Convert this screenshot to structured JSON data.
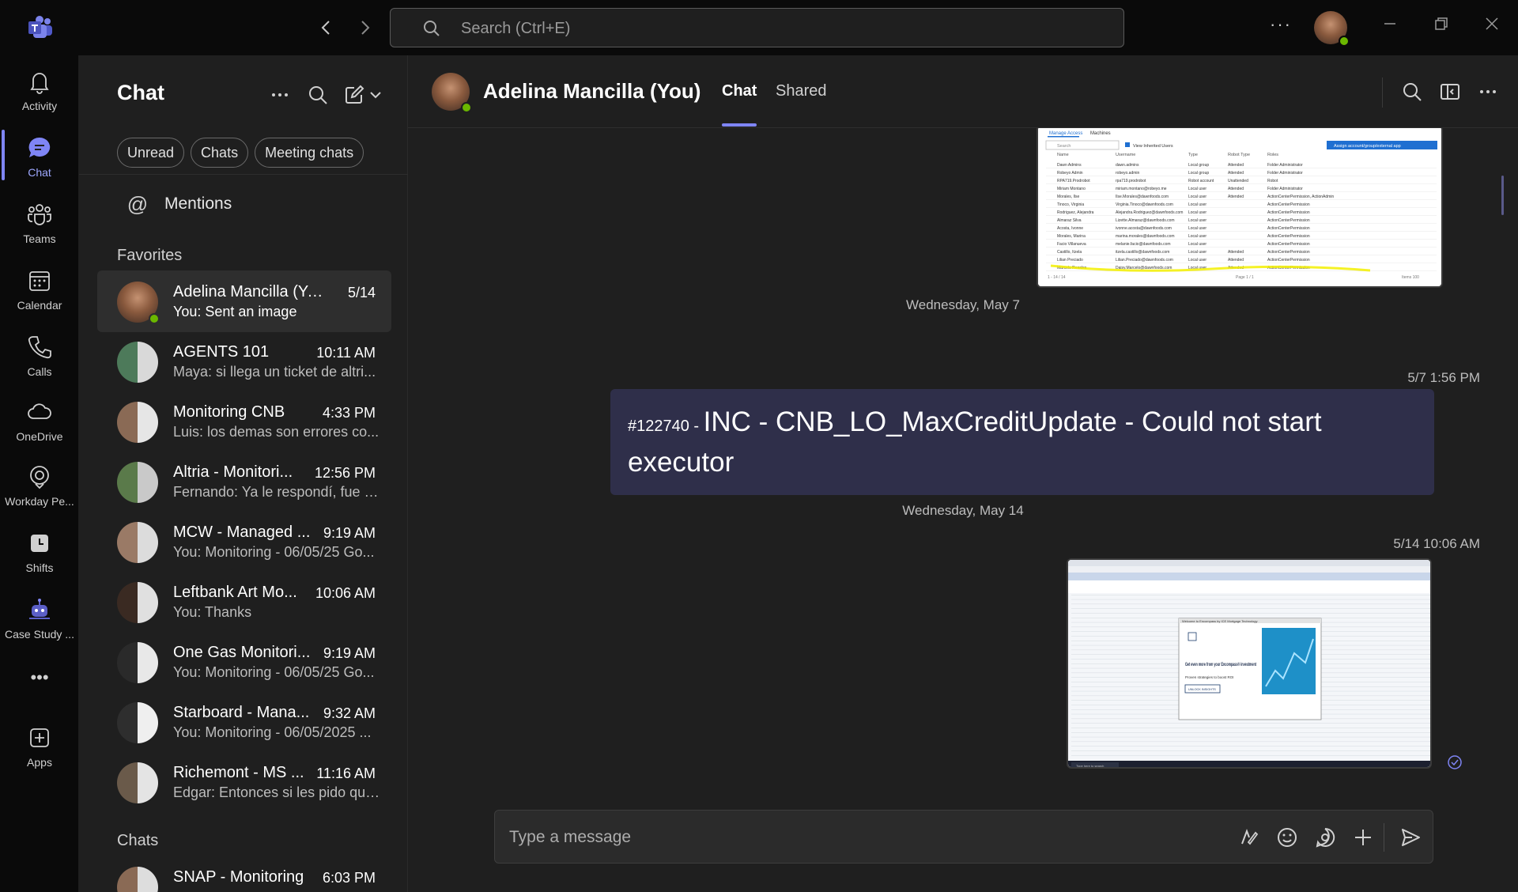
{
  "titlebar": {
    "search_placeholder": "Search (Ctrl+E)",
    "more_label": "···"
  },
  "rail": {
    "items": [
      {
        "label": "Activity",
        "icon": "bell-icon"
      },
      {
        "label": "Chat",
        "icon": "chat-icon",
        "active": true
      },
      {
        "label": "Teams",
        "icon": "teams-icon"
      },
      {
        "label": "Calendar",
        "icon": "calendar-icon"
      },
      {
        "label": "Calls",
        "icon": "phone-icon"
      },
      {
        "label": "OneDrive",
        "icon": "cloud-icon"
      },
      {
        "label": "Workday Pe...",
        "icon": "workday-icon"
      },
      {
        "label": "Shifts",
        "icon": "shifts-icon"
      },
      {
        "label": "Case Study ...",
        "icon": "bot-icon"
      },
      {
        "label": "Apps",
        "icon": "add-app-icon"
      }
    ],
    "more_label": "•••"
  },
  "chat_list": {
    "title": "Chat",
    "filters": [
      "Unread",
      "Chats",
      "Meeting chats"
    ],
    "mentions_label": "Mentions",
    "favorites_label": "Favorites",
    "chats_label": "Chats",
    "favorites": [
      {
        "name": "Adelina Mancilla (You)",
        "time": "5/14",
        "preview": "You: Sent an image",
        "selected": true
      },
      {
        "name": "AGENTS 101",
        "time": "10:11 AM",
        "preview": "Maya: si llega un ticket de altri..."
      },
      {
        "name": "Monitoring CNB",
        "time": "4:33 PM",
        "preview": "Luis: los demas son errores co..."
      },
      {
        "name": "Altria - Monitori...",
        "time": "12:56 PM",
        "preview": "Fernando: Ya le respondí, fue q..."
      },
      {
        "name": "MCW - Managed ...",
        "time": "9:19 AM",
        "preview": "You: Monitoring - 06/05/25 Go..."
      },
      {
        "name": "Leftbank Art Mo...",
        "time": "10:06 AM",
        "preview": "You: Thanks"
      },
      {
        "name": "One Gas Monitori...",
        "time": "9:19 AM",
        "preview": "You: Monitoring - 06/05/25 Go..."
      },
      {
        "name": "Starboard - Mana...",
        "time": "9:32 AM",
        "preview": "You: Monitoring - 06/05/2025 ..."
      },
      {
        "name": "Richemont - MS ...",
        "time": "11:16 AM",
        "preview": "Edgar: Entonces si les pido que..."
      }
    ],
    "chats": [
      {
        "name": "SNAP - Monitoring",
        "time": "6:03 PM",
        "preview": ""
      }
    ]
  },
  "conversation": {
    "name": "Adelina Mancilla (You)",
    "tabs": [
      "Chat",
      "Shared"
    ],
    "date_sep_1": "Wednesday, May 7",
    "msg1_time": "5/7 1:56 PM",
    "msg1_ticket": "#122740 - ",
    "msg1_text": "INC - CNB_LO_MaxCreditUpdate - Could not start executor",
    "date_sep_2": "Wednesday, May 14",
    "msg2_time": "5/14 10:06 AM",
    "compose_placeholder": "Type a message"
  },
  "screenshot1": {
    "tabs": [
      "Manage Access",
      "Machines"
    ],
    "search": "Search",
    "checkbox": "View Inherited Users",
    "button": "Assign account/group/external app",
    "headers": [
      "Name",
      "Username",
      "Type",
      "Robot Type",
      "Roles"
    ],
    "rows": [
      [
        "Dawn Admins",
        "dawn.admins",
        "Local group",
        "Attended",
        "Folder Administrator"
      ],
      [
        "Robeyo Admin",
        "robeyo.admin",
        "Local group",
        "Attended",
        "Folder Administrator"
      ],
      [
        "RPA719.Prodrobot",
        "rpa719.prodrobot",
        "Robot account",
        "Unattended",
        "Robot"
      ],
      [
        "Miriam Montano",
        "miriam.montano@robeyo.me",
        "Local user",
        "Attended",
        "Folder Administrator"
      ],
      [
        "Morales, Ilse",
        "Ilse.Morales@dawnfoods.com",
        "Local user",
        "Attended",
        "ActionCenterPermission, ActionAdmin"
      ],
      [
        "Tinoco, Virginia",
        "Virginia.Tinoco@dawnfoods.com",
        "Local user",
        "",
        "ActionCenterPermission"
      ],
      [
        "Rodriguez, Alejandra",
        "Alejandra.Rodriguez@dawnfoods.com",
        "Local user",
        "",
        "ActionCenterPermission"
      ],
      [
        "Almaraz Silva",
        "Lizette.Almaraz@dawnfoods.com",
        "Local user",
        "",
        "ActionCenterPermission"
      ],
      [
        "Acosta, Ivonne",
        "ivonne.acosta@dawnfoods.com",
        "Local user",
        "",
        "ActionCenterPermission"
      ],
      [
        "Morales, Marina",
        "marina.morales@dawnfoods.com",
        "Local user",
        "",
        "ActionCenterPermission"
      ],
      [
        "Facio Villanueva",
        "melanie.facio@dawnfoods.com",
        "Local user",
        "",
        "ActionCenterPermission"
      ],
      [
        "Castillo, Itzela",
        "itzela.castillo@dawnfoods.com",
        "Local user",
        "Attended",
        "ActionCenterPermission"
      ],
      [
        "Lilian Preciado",
        "Lilian.Preciado@dawnfoods.com",
        "Local user",
        "Attended",
        "ActionCenterPermission"
      ],
      [
        "Marcelo Rosales",
        "Daisy.Marcelo@dawnfoods.com",
        "Local user",
        "Attended",
        "ActionCenterPermission"
      ]
    ],
    "footer_left": "1 - 14 / 14",
    "footer_mid": "Page 1 / 1",
    "footer_right": "Items 100"
  },
  "screenshot2": {
    "popup_title": "Welcome to Encompass by ICE Mortgage Technology",
    "popup_heading": "Get even more from your Encompass® investment",
    "popup_sub": "Proven strategies to boost ROI",
    "popup_button": "UNLOCK INSIGHTS",
    "taskbar_search": "Type here to search"
  },
  "colors": {
    "accent": "#7f85f5",
    "bubble": "#2f2f4a",
    "presence": "#6bb700",
    "highlight": "#f3f000"
  }
}
